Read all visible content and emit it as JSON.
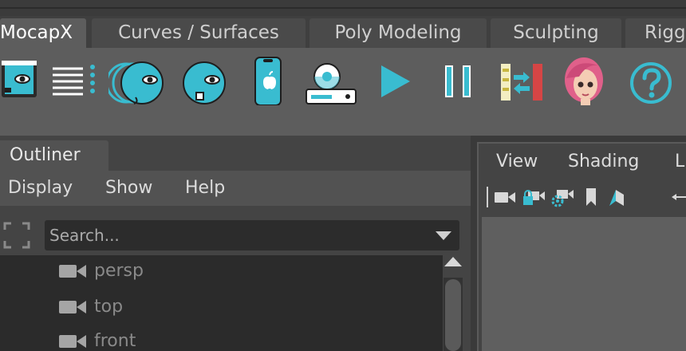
{
  "shelf_tabs": [
    {
      "label": "MocapX",
      "active": true
    },
    {
      "label": "Curves / Surfaces",
      "active": false
    },
    {
      "label": "Poly Modeling",
      "active": false
    },
    {
      "label": "Sculpting",
      "active": false
    },
    {
      "label": "Rigg",
      "active": false
    }
  ],
  "shelf_icons": [
    "face-device-icon",
    "list-menu-icon",
    "multi-face-icon",
    "face-capture-icon",
    "phone-icon",
    "record-device-icon",
    "play-icon",
    "pause-icon",
    "sequence-swap-icon",
    "avatar-icon",
    "help-icon"
  ],
  "accent_color": "#39bcd0",
  "outliner": {
    "tab_label": "Outliner",
    "menu": [
      "Display",
      "Show",
      "Help"
    ],
    "search_placeholder": "Search...",
    "items": [
      "persp",
      "top",
      "front"
    ]
  },
  "viewport": {
    "menu": [
      "View",
      "Shading",
      "L"
    ],
    "toolbar_icons": [
      "camera-icon",
      "lock-camera-icon",
      "camera-attributes-icon",
      "bookmark-icon",
      "image-plane-icon",
      "arrow-icon"
    ]
  }
}
